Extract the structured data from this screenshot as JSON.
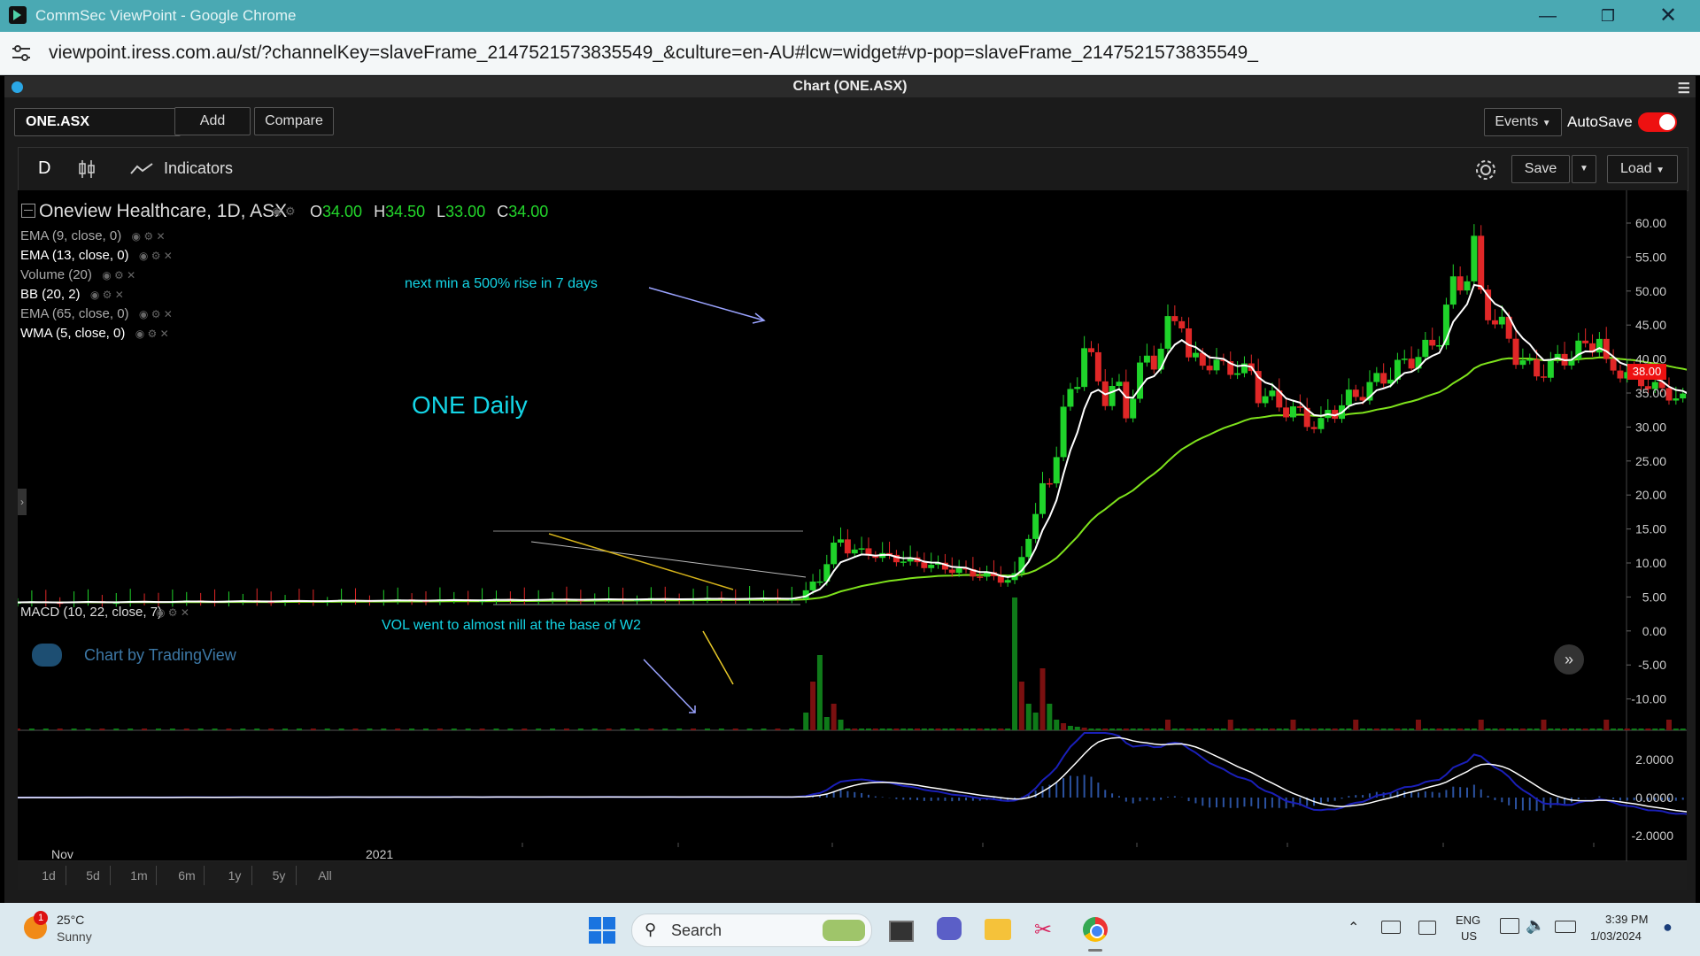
{
  "browser": {
    "window_title": "CommSec ViewPoint - Google Chrome",
    "url": "viewpoint.iress.com.au/st/?channelKey=slaveFrame_2147521573835549_&culture=en-AU#lcw=widget#vp-pop=slaveFrame_2147521573835549_"
  },
  "panel": {
    "title": "Chart (ONE.ASX)"
  },
  "toolbar": {
    "symbol": "ONE.ASX",
    "add_label": "Add",
    "compare_label": "Compare",
    "events_label": "Events",
    "autosave_label": "AutoSave",
    "autosave_on": true,
    "interval": "D",
    "indicators_label": "Indicators",
    "save_label": "Save",
    "load_label": "Load"
  },
  "legend": {
    "symbol_title": "Oneview Healthcare, 1D, ASX",
    "o_label": "O",
    "o_value": "34.00",
    "h_label": "H",
    "h_value": "34.50",
    "l_label": "L",
    "l_value": "33.00",
    "c_label": "C",
    "c_value": "34.00",
    "studies": [
      "EMA (9, close, 0)",
      "EMA (13, close, 0)",
      "Volume (20)",
      "BB (20, 2)",
      "EMA (65, close, 0)",
      "WMA (5, close, 0)"
    ],
    "macd_label": "MACD (10, 22, close, 7)"
  },
  "annotations": {
    "main_label": "ONE Daily",
    "note_rise": "next min a 500% rise in 7 days",
    "note_vol": "VOL went to almost nill at the base of W2"
  },
  "watermark": "Chart by TradingView",
  "current_price_tag": "38.00",
  "colors": {
    "up": "#1fd32a",
    "down": "#e02727",
    "ema_slow": "#7ee21c",
    "fast_line": "#ffffff",
    "annotation": "#14d5e6",
    "macd_line": "#1a1fb8"
  },
  "chart_data": {
    "type": "candlestick",
    "price_axis_ticks": [
      "60.00",
      "55.00",
      "50.00",
      "45.00",
      "40.00",
      "35.00",
      "30.00",
      "25.00",
      "20.00",
      "15.00",
      "10.00",
      "5.00",
      "0.00",
      "-5.00",
      "-10.00"
    ],
    "macd_axis_ticks": [
      "2.0000",
      "0.0000",
      "-2.0000"
    ],
    "x_tick_labels": [
      "Nov",
      "2021"
    ],
    "price_ylim": [
      -15,
      65
    ],
    "ohlc_last": {
      "open": 34.0,
      "high": 34.5,
      "low": 33.0,
      "close": 34.0
    }
  },
  "range_buttons": [
    "1d",
    "5d",
    "1m",
    "6m",
    "1y",
    "5y",
    "All"
  ],
  "taskbar": {
    "weather_temp": "25°C",
    "weather_desc": "Sunny",
    "weather_badge": "1",
    "search_label": "Search",
    "lang_1": "ENG",
    "lang_2": "US",
    "time": "3:39 PM",
    "date": "1/03/2024"
  }
}
